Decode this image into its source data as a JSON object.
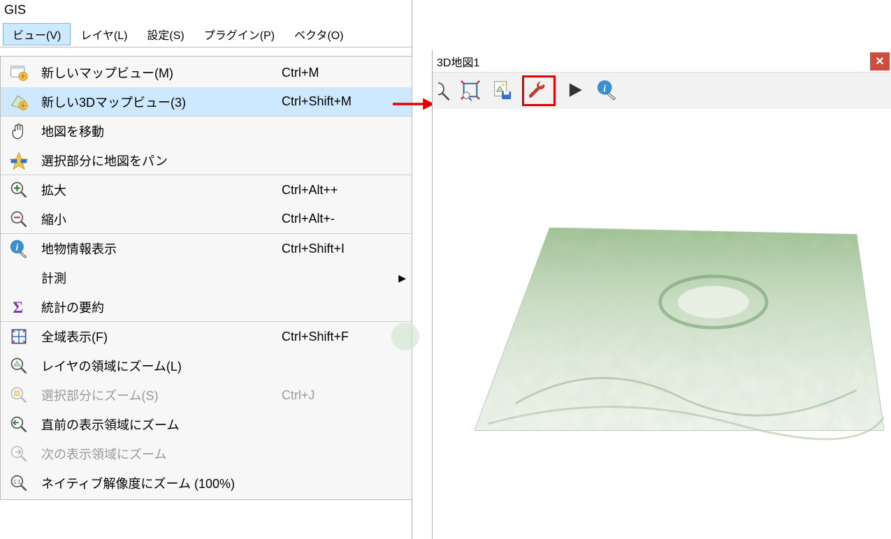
{
  "app_title": "GIS",
  "menubar": {
    "items": [
      {
        "label": "ビュー(V)",
        "active": true
      },
      {
        "label": "レイヤ(L)",
        "active": false
      },
      {
        "label": "設定(S)",
        "active": false
      },
      {
        "label": "プラグイン(P)",
        "active": false
      },
      {
        "label": "ベクタ(O)",
        "active": false
      }
    ]
  },
  "dropdown": [
    {
      "icon": "new-map-view-icon",
      "label": "新しいマップビュー(M)",
      "shortcut": "Ctrl+M",
      "highlight": false,
      "sep": false
    },
    {
      "icon": "new-3d-map-view-icon",
      "label": "新しい3Dマップビュー(3)",
      "shortcut": "Ctrl+Shift+M",
      "highlight": true,
      "sep": true
    },
    {
      "icon": "pan-icon",
      "label": "地図を移動",
      "shortcut": "",
      "highlight": false,
      "sep": false
    },
    {
      "icon": "pan-to-selection-icon",
      "label": "選択部分に地図をパン",
      "shortcut": "",
      "highlight": false,
      "sep": true
    },
    {
      "icon": "zoom-in-icon",
      "label": "拡大",
      "shortcut": "Ctrl+Alt++",
      "highlight": false,
      "sep": false
    },
    {
      "icon": "zoom-out-icon",
      "label": "縮小",
      "shortcut": "Ctrl+Alt+-",
      "highlight": false,
      "sep": true
    },
    {
      "icon": "identify-icon",
      "label": "地物情報表示",
      "shortcut": "Ctrl+Shift+I",
      "highlight": false,
      "sep": false
    },
    {
      "icon": "",
      "label": "計測",
      "shortcut": "",
      "highlight": false,
      "sep": false,
      "submenu": true
    },
    {
      "icon": "sigma-icon",
      "label": "統計の要約",
      "shortcut": "",
      "highlight": false,
      "sep": true
    },
    {
      "icon": "zoom-full-icon",
      "label": "全域表示(F)",
      "shortcut": "Ctrl+Shift+F",
      "highlight": false,
      "sep": false
    },
    {
      "icon": "zoom-to-layer-icon",
      "label": "レイヤの領域にズーム(L)",
      "shortcut": "",
      "highlight": false,
      "sep": false
    },
    {
      "icon": "zoom-to-selection-icon",
      "label": "選択部分にズーム(S)",
      "shortcut": "Ctrl+J",
      "highlight": false,
      "sep": false,
      "disabled": true
    },
    {
      "icon": "zoom-last-icon",
      "label": "直前の表示領域にズーム",
      "shortcut": "",
      "highlight": false,
      "sep": false
    },
    {
      "icon": "zoom-next-icon",
      "label": "次の表示領域にズーム",
      "shortcut": "",
      "highlight": false,
      "sep": false,
      "disabled": true
    },
    {
      "icon": "zoom-native-icon",
      "label": "ネイティブ解像度にズーム (100%)",
      "shortcut": "",
      "highlight": false,
      "sep": false
    }
  ],
  "panel3d": {
    "title": "3D地図1",
    "close": "✕",
    "toolbar": [
      {
        "name": "zoom-full-button",
        "icon": "fullscreen-icon",
        "highlight": false
      },
      {
        "name": "save-image-button",
        "icon": "save-image-icon",
        "highlight": false
      },
      {
        "name": "settings-button",
        "icon": "wrench-icon",
        "highlight": true
      },
      {
        "name": "play-animation-button",
        "icon": "play-icon",
        "highlight": false
      },
      {
        "name": "identify-button",
        "icon": "identify-cursor-icon",
        "highlight": false
      }
    ]
  },
  "colors": {
    "highlight_bg": "#cde8ff",
    "highlight_border": "#7ab8e8",
    "annotation_red": "#e30000",
    "close_btn": "#d04c3d"
  }
}
